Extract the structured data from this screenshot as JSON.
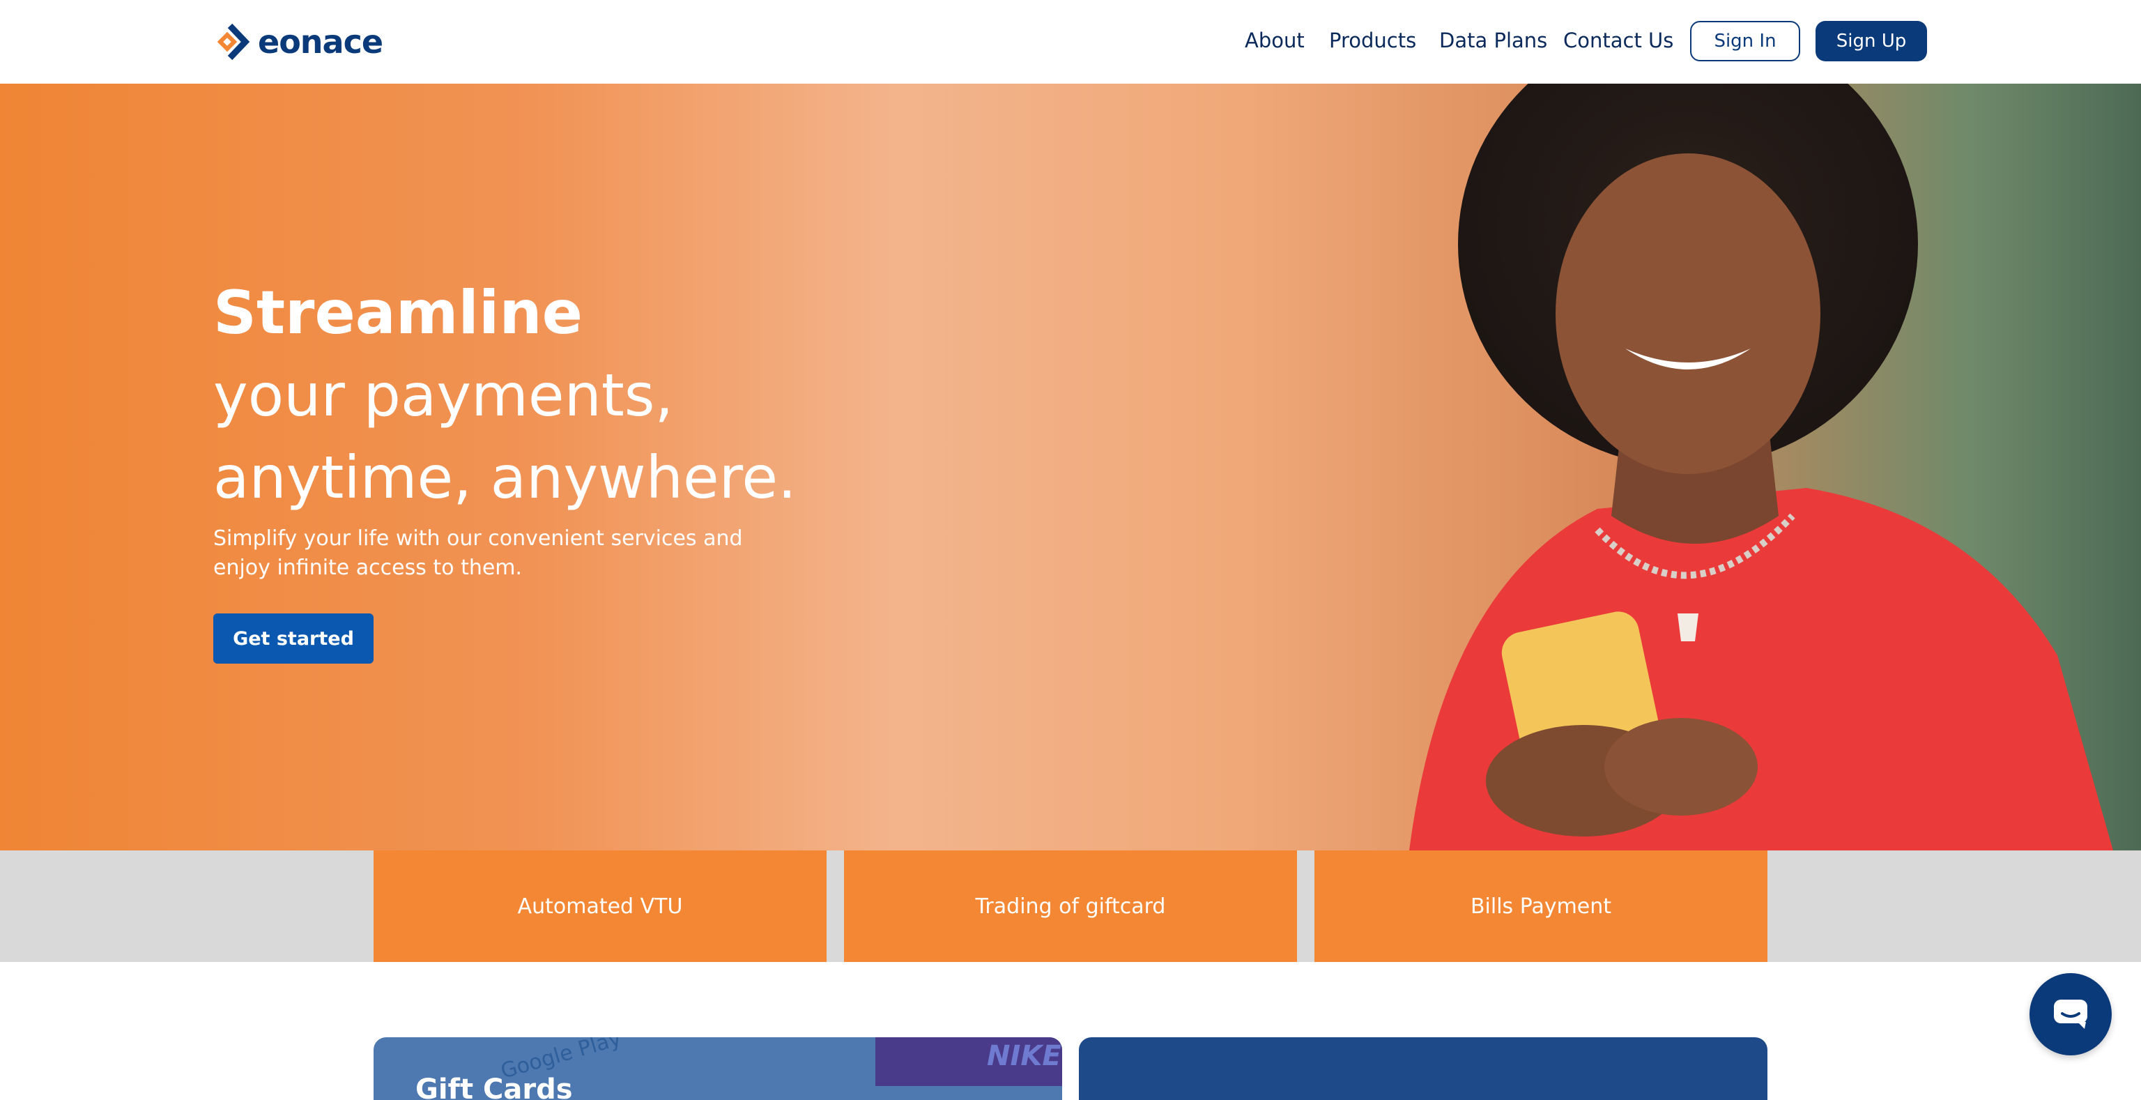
{
  "brand": {
    "name": "eonace"
  },
  "nav": {
    "links": [
      "About",
      "Products",
      "Data Plans",
      "Contact Us"
    ],
    "sign_in": "Sign In",
    "sign_up": "Sign Up"
  },
  "hero": {
    "title_strong": "Streamline",
    "title_line2": "your payments,",
    "title_line3": "anytime, anywhere.",
    "subtitle": "Simplify your life with our convenient services and enjoy infinite access to them.",
    "cta": "Get started"
  },
  "services": [
    "Automated VTU",
    "Trading of giftcard",
    "Bills Payment"
  ],
  "cards": {
    "left_title": "Gift Cards",
    "left_partial_text": "Google Play"
  },
  "colors": {
    "primary": "#0b3a7a",
    "accent": "#f38733",
    "strip_bg": "#d9d9d9"
  },
  "icons": {
    "chat": "chat-bubble-icon"
  }
}
